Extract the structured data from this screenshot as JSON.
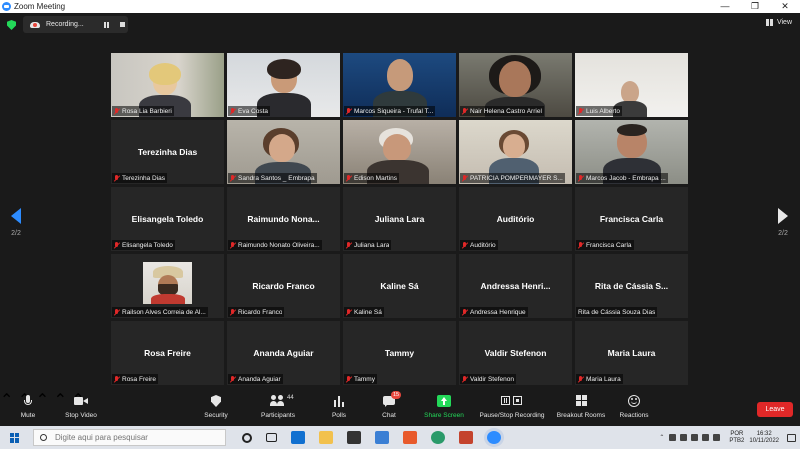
{
  "window": {
    "title": "Zoom Meeting"
  },
  "recording": {
    "label": "Recording..."
  },
  "view": {
    "label": "View"
  },
  "pager": {
    "left": "2/2",
    "right": "2/2"
  },
  "participants_grid": [
    {
      "name": "Rosa Lia Barbieri",
      "video": true
    },
    {
      "name": "Eva Costa",
      "video": true
    },
    {
      "name": "Marcos Siqueira - Trufal T...",
      "video": true
    },
    {
      "name": "Nair Helena Castro Arriel",
      "video": true
    },
    {
      "name": "Luis Alberto",
      "video": true
    },
    {
      "name": "Terezinha Dias",
      "display": "Terezinha Dias",
      "video": false
    },
    {
      "name": "Sandra Santos _ Embrapa",
      "video": true
    },
    {
      "name": "Edison Martins",
      "video": true
    },
    {
      "name": "PATRICIA POMPERMAYER S...",
      "video": true
    },
    {
      "name": "Marcos Jacob - Embrapa ...",
      "video": true
    },
    {
      "name": "Elisangela Toledo",
      "display": "Elisangela Toledo",
      "video": false
    },
    {
      "name": "Raimundo Nonato Oliveira...",
      "display": "Raimundo  Nona...",
      "video": false
    },
    {
      "name": "Juliana Lara",
      "display": "Juliana Lara",
      "video": false
    },
    {
      "name": "Auditório",
      "display": "Auditório",
      "video": false
    },
    {
      "name": "Francisca Carla",
      "display": "Francisca Carla",
      "video": false
    },
    {
      "name": "Railson Alves Correia de Al...",
      "video": false,
      "photo": true
    },
    {
      "name": "Ricardo Franco",
      "display": "Ricardo Franco",
      "video": false
    },
    {
      "name": "Kaline Sá",
      "display": "Kaline Sá",
      "video": false
    },
    {
      "name": "Andressa Henrique",
      "display": "Andressa  Henri...",
      "video": false
    },
    {
      "name": "Rita de Cássia Souza Dias",
      "display": "Rita de Cássia S...",
      "video": false,
      "unmuted": true
    },
    {
      "name": "Rosa Freire",
      "display": "Rosa Freire",
      "video": false
    },
    {
      "name": "Ananda Aguiar",
      "display": "Ananda Aguiar",
      "video": false
    },
    {
      "name": "Tammy",
      "display": "Tammy",
      "video": false
    },
    {
      "name": "Valdir Stefenon",
      "display": "Valdir Stefenon",
      "video": false
    },
    {
      "name": "Maria Laura",
      "display": "Maria Laura",
      "video": false
    }
  ],
  "toolbar": {
    "mute": "Mute",
    "stop_video": "Stop Video",
    "security": "Security",
    "participants": "Participants",
    "participants_count": "44",
    "polls": "Polls",
    "chat": "Chat",
    "chat_badge": "15",
    "share_screen": "Share Screen",
    "pause_recording": "Pause/Stop Recording",
    "breakout_rooms": "Breakout Rooms",
    "reactions": "Reactions",
    "leave": "Leave"
  },
  "taskbar": {
    "search_placeholder": "Digite aqui para pesquisar",
    "lang_top": "POR",
    "lang_bottom": "PTB2",
    "time": "16:32",
    "date": "10/11/2022"
  },
  "colors": {
    "accent": "#2d8cff",
    "leave": "#e02828",
    "share": "#23d959",
    "muted_mic": "#e02828"
  }
}
